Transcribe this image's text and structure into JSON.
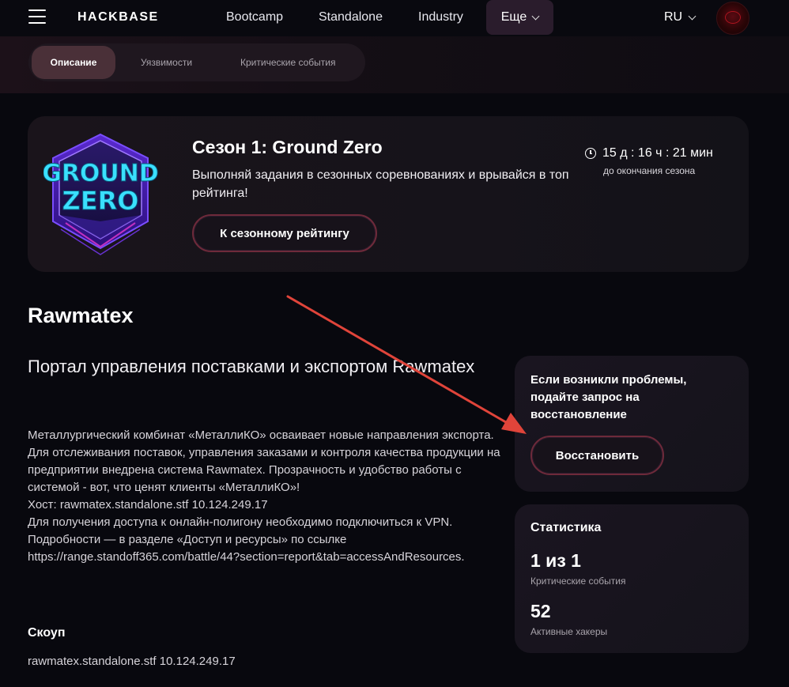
{
  "header": {
    "logo": "HACKBASE",
    "nav": [
      "Bootcamp",
      "Standalone",
      "Industry"
    ],
    "more_label": "Еще",
    "lang": "RU"
  },
  "tabs": [
    "Описание",
    "Уязвимости",
    "Критические события"
  ],
  "season": {
    "logo_line1": "GROUND",
    "logo_line2": "ZERO",
    "title": "Сезон 1: Ground Zero",
    "description": "Выполняй задания в сезонных соревнованиях и врывайся в топ рейтинга!",
    "button_label": "К сезонному рейтингу",
    "timer": "15 д : 16 ч : 21 мин",
    "timer_caption": "до окончания сезона"
  },
  "main": {
    "title": "Rawmatex",
    "subtitle": "Портал управления поставками и экспортом Rawmatex",
    "description": [
      "Металлургический комбинат «МеталлиКО» осваивает новые направления экспорта. Для отслеживания поставок, управления заказами и контроля качества продукции на предприятии внедрена система Rawmatex. Прозрачность и удобство работы с системой - вот, что ценят клиенты «МеталлиКО»!",
      "Хост: rawmatex.standalone.stf 10.124.249.17",
      "Для получения доступа к онлайн-полигону необходимо подключиться к VPN. Подробности — в разделе «Доступ и ресурсы» по ссылке https://range.standoff365.com/battle/44?section=report&tab=accessAndResources."
    ],
    "scope_title": "Скоуп",
    "scope_value": "rawmatex.standalone.stf 10.124.249.17"
  },
  "restore_card": {
    "text": "Если возникли проблемы, подайте запрос на восстановление",
    "button_label": "Восстановить"
  },
  "stats": {
    "title": "Статистика",
    "critical_value": "1 из 1",
    "critical_label": "Критические события",
    "hackers_value": "52",
    "hackers_label": "Активные хакеры"
  },
  "colors": {
    "background": "#08080e",
    "card": "#1a1520",
    "button_border": "#6e2a3a",
    "annotation_arrow": "#e0443a",
    "logo_neon": "#2fd8ff"
  }
}
